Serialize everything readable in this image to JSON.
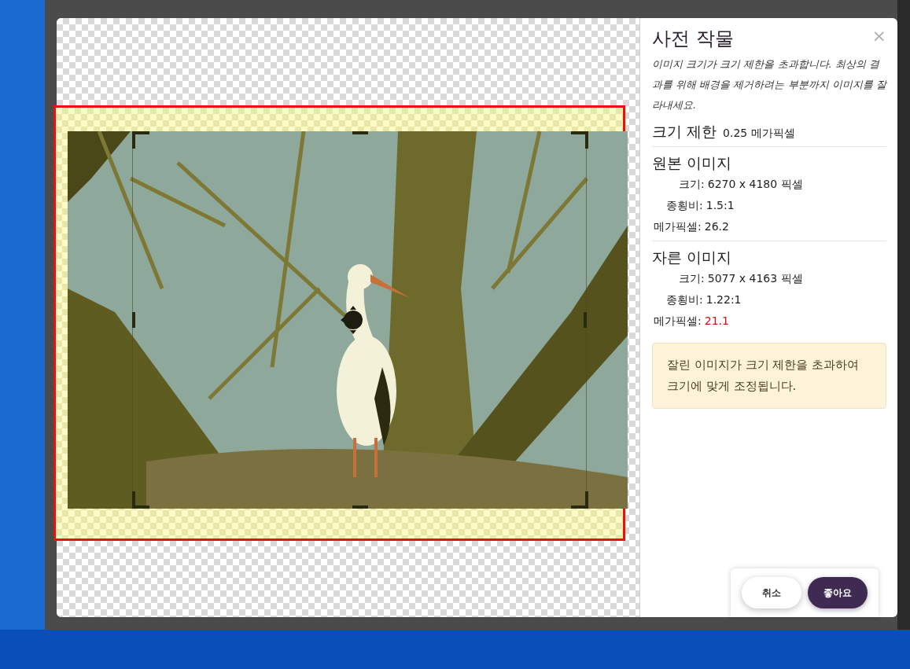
{
  "dialog": {
    "title": "사전 작물",
    "close": "×",
    "description": "이미지 크기가 크기 제한을 초과합니다. 최상의 결과를 위해 배경을 제거하려는 부분까지 이미지를 잘라내세요.",
    "size_limit": {
      "label": "크기 제한",
      "value": "0.25 메가픽셀"
    },
    "sections": [
      {
        "title": "원본 이미지",
        "rows": [
          {
            "label": "크기:",
            "value": "6270 x 4180 픽셀",
            "alert": false
          },
          {
            "label": "종횡비:",
            "value": "1.5:1",
            "alert": false
          },
          {
            "label": "메가픽셀:",
            "value": "26.2",
            "alert": false
          }
        ]
      },
      {
        "title": "자른 이미지",
        "rows": [
          {
            "label": "크기:",
            "value": "5077 x 4163 픽셀",
            "alert": false
          },
          {
            "label": "종횡비:",
            "value": "1.22:1",
            "alert": false
          },
          {
            "label": "메가픽셀:",
            "value": "21.1",
            "alert": true
          }
        ]
      }
    ],
    "notice": "잘린 이미지가 크기 제한을 초과하여 크기에 맞게 조정됩니다.",
    "buttons": [
      {
        "label": "취소",
        "kind": "secondary"
      },
      {
        "label": "좋아요",
        "kind": "primary"
      }
    ]
  }
}
